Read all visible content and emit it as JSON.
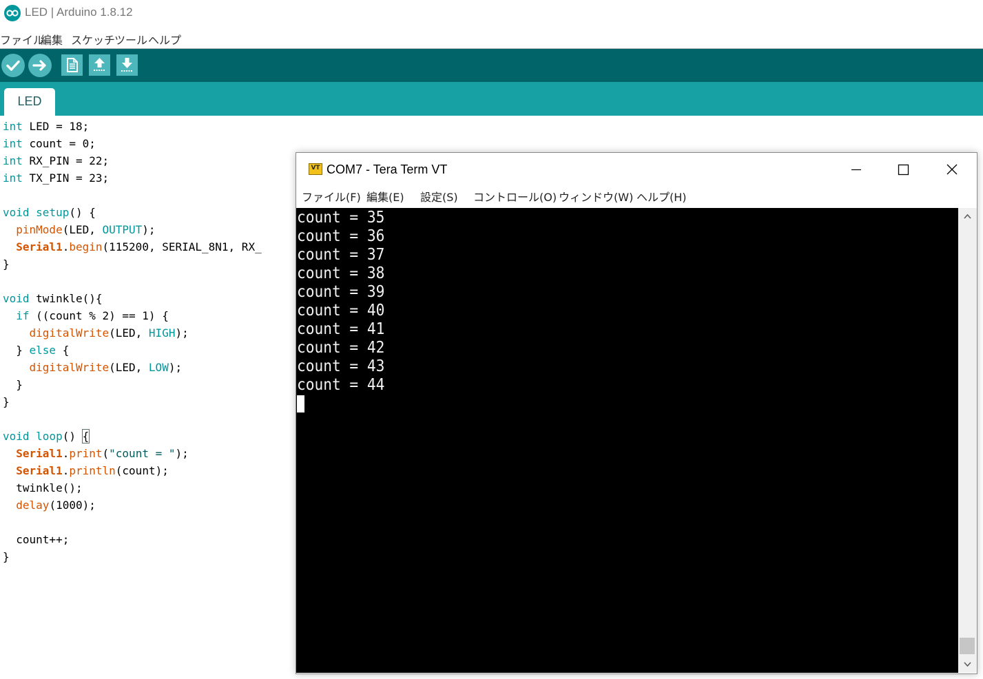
{
  "arduino": {
    "title": "LED | Arduino 1.8.12",
    "menu": [
      "ファイル",
      "編集",
      "スケッチ",
      "ツール",
      "ヘルプ"
    ],
    "toolbar": {
      "icons": [
        "verify-icon",
        "upload-icon",
        "new-icon",
        "open-icon",
        "save-icon"
      ]
    },
    "tab": "LED",
    "colors": {
      "toolbar": "#006468",
      "tabbar": "#17a1a5",
      "button": "#4db7bb",
      "keyword": "#00979c",
      "function": "#d35400"
    },
    "code": [
      [
        {
          "t": "int",
          "c": "kw"
        },
        {
          "t": " LED = 18;"
        }
      ],
      [
        {
          "t": "int",
          "c": "kw"
        },
        {
          "t": " count = 0;"
        }
      ],
      [
        {
          "t": "int",
          "c": "kw"
        },
        {
          "t": " RX_PIN = 22;"
        }
      ],
      [
        {
          "t": "int",
          "c": "kw"
        },
        {
          "t": " TX_PIN = 23;"
        }
      ],
      [],
      [
        {
          "t": "void",
          "c": "kw"
        },
        {
          "t": " "
        },
        {
          "t": "setup",
          "c": "kw"
        },
        {
          "t": "() {"
        }
      ],
      [
        {
          "t": "  "
        },
        {
          "t": "pinMode",
          "c": "fn"
        },
        {
          "t": "(LED, "
        },
        {
          "t": "OUTPUT",
          "c": "const"
        },
        {
          "t": ");"
        }
      ],
      [
        {
          "t": "  "
        },
        {
          "t": "Serial1",
          "c": "ser"
        },
        {
          "t": "."
        },
        {
          "t": "begin",
          "c": "fn"
        },
        {
          "t": "(115200, SERIAL_8N1, RX_"
        }
      ],
      [
        {
          "t": "}"
        }
      ],
      [],
      [
        {
          "t": "void",
          "c": "kw"
        },
        {
          "t": " twinkle(){"
        }
      ],
      [
        {
          "t": "  "
        },
        {
          "t": "if",
          "c": "kw"
        },
        {
          "t": " ((count % 2) == 1) {"
        }
      ],
      [
        {
          "t": "    "
        },
        {
          "t": "digitalWrite",
          "c": "fn"
        },
        {
          "t": "(LED, "
        },
        {
          "t": "HIGH",
          "c": "const"
        },
        {
          "t": ");"
        }
      ],
      [
        {
          "t": "  } "
        },
        {
          "t": "else",
          "c": "kw"
        },
        {
          "t": " {"
        }
      ],
      [
        {
          "t": "    "
        },
        {
          "t": "digitalWrite",
          "c": "fn"
        },
        {
          "t": "(LED, "
        },
        {
          "t": "LOW",
          "c": "const"
        },
        {
          "t": ");"
        }
      ],
      [
        {
          "t": "  }"
        }
      ],
      [
        {
          "t": "}"
        }
      ],
      [],
      [
        {
          "t": "void",
          "c": "kw"
        },
        {
          "t": " "
        },
        {
          "t": "loop",
          "c": "kw"
        },
        {
          "t": "() "
        },
        {
          "t": "{",
          "c": "brace"
        }
      ],
      [
        {
          "t": "  "
        },
        {
          "t": "Serial1",
          "c": "ser"
        },
        {
          "t": "."
        },
        {
          "t": "print",
          "c": "fn"
        },
        {
          "t": "("
        },
        {
          "t": "\"count = \"",
          "c": "str"
        },
        {
          "t": ");"
        }
      ],
      [
        {
          "t": "  "
        },
        {
          "t": "Serial1",
          "c": "ser"
        },
        {
          "t": "."
        },
        {
          "t": "println",
          "c": "fn"
        },
        {
          "t": "(count);"
        }
      ],
      [
        {
          "t": "  twinkle();"
        }
      ],
      [
        {
          "t": "  "
        },
        {
          "t": "delay",
          "c": "fn"
        },
        {
          "t": "(1000);"
        }
      ],
      [],
      [
        {
          "t": "  count++;"
        }
      ],
      [
        {
          "t": "}"
        }
      ]
    ]
  },
  "teraterm": {
    "icon_label": "VT",
    "title": "COM7 - Tera Term VT",
    "menu": [
      "ファイル(F)",
      "編集(E)",
      "設定(S)",
      "コントロール(O)",
      "ウィンドウ(W)",
      "ヘルプ(H)"
    ],
    "window_controls": [
      "minimize-icon",
      "maximize-icon",
      "close-icon"
    ],
    "output": [
      "count = 35",
      "count = 36",
      "count = 37",
      "count = 38",
      "count = 39",
      "count = 40",
      "count = 41",
      "count = 42",
      "count = 43",
      "count = 44"
    ],
    "scroll_position": 0.96
  }
}
